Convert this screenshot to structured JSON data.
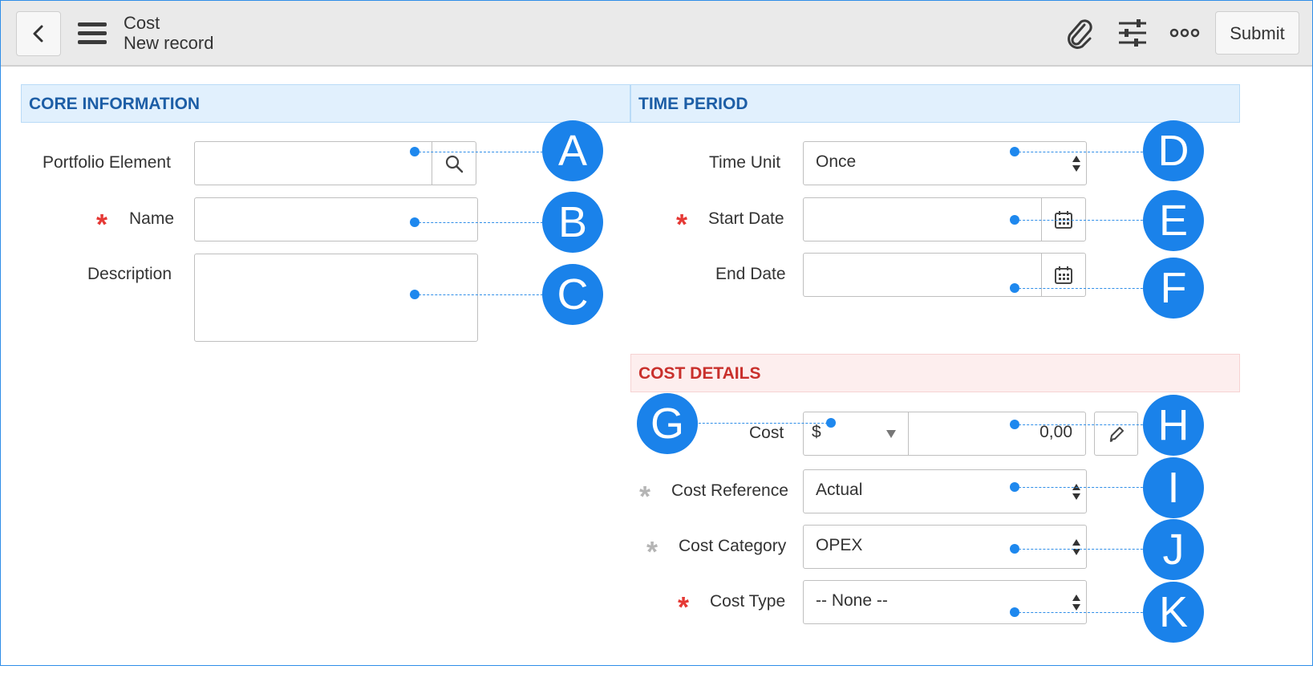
{
  "header": {
    "back_icon": "chevron-left-icon",
    "menu_icon": "hamburger-menu-icon",
    "title": "Cost",
    "subtitle": "New record",
    "attach_icon": "paperclip-icon",
    "settings_icon": "sliders-icon",
    "more_icon": "more-options-icon",
    "submit_label": "Submit"
  },
  "sections": {
    "core": "CORE INFORMATION",
    "time": "TIME PERIOD",
    "cost": "COST DETAILS"
  },
  "core": {
    "portfolio_label": "Portfolio Element",
    "portfolio_value": "",
    "name_label": "Name",
    "name_value": "",
    "description_label": "Description",
    "description_value": ""
  },
  "time": {
    "time_unit_label": "Time Unit",
    "time_unit_value": "Once",
    "start_label": "Start Date",
    "start_value": "",
    "end_label": "End Date",
    "end_value": ""
  },
  "cost": {
    "cost_label": "Cost",
    "currency": "$",
    "amount": "0,00",
    "reference_label": "Cost Reference",
    "reference_value": "Actual",
    "category_label": "Cost Category",
    "category_value": "OPEX",
    "type_label": "Cost Type",
    "type_value": "-- None --"
  },
  "callouts": [
    "A",
    "B",
    "C",
    "D",
    "E",
    "F",
    "G",
    "H",
    "I",
    "J",
    "K"
  ],
  "colors": {
    "accent": "#1a82ea",
    "required": "#e53935",
    "section_blue": "#e1f0fd",
    "section_red": "#fdeeee"
  }
}
